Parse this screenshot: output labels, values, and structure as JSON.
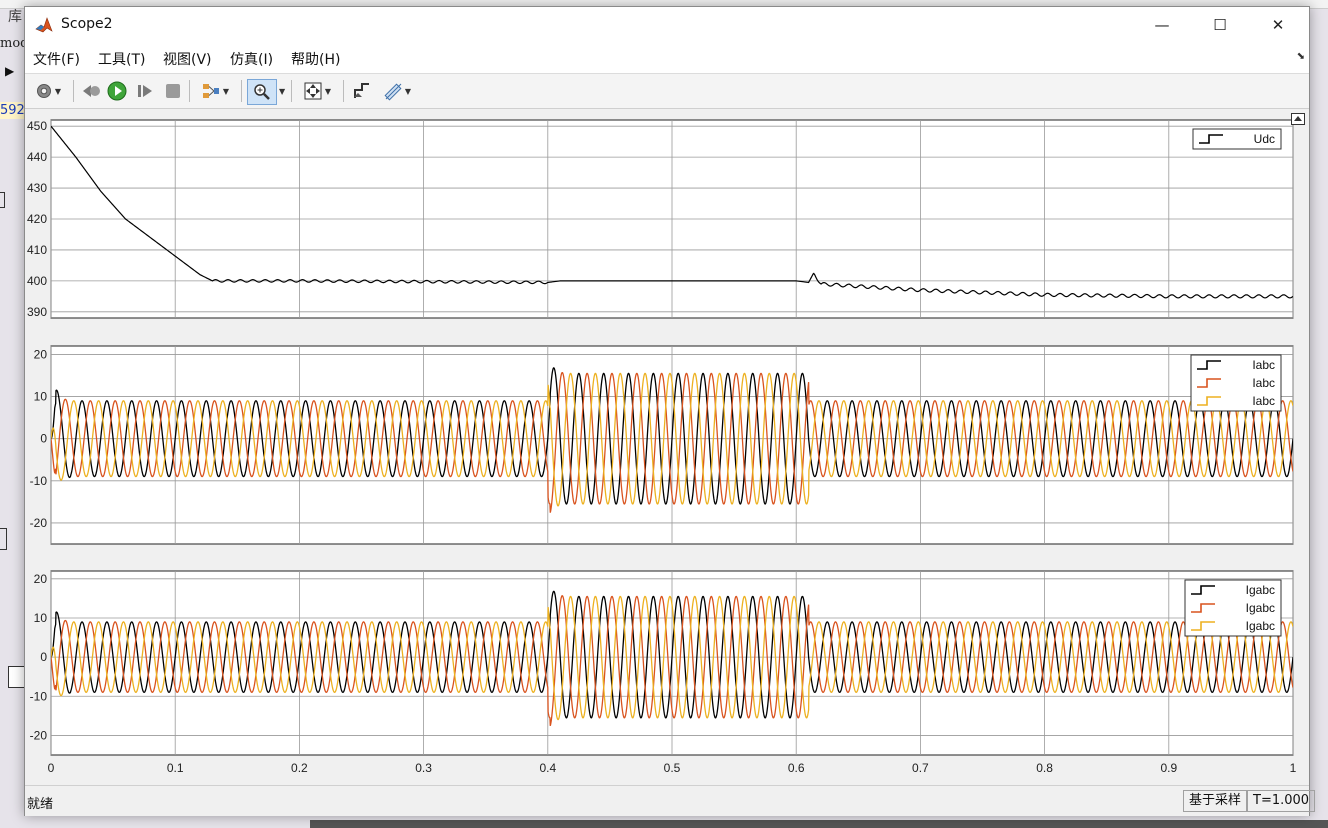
{
  "background": {
    "lib_label": "库",
    "model_label": "mode",
    "link_label": "592"
  },
  "window": {
    "title": "Scope2",
    "controls": {
      "minimize": "—",
      "maximize": "☐",
      "close": "✕"
    }
  },
  "menu": [
    "文件(F)",
    "工具(T)",
    "视图(V)",
    "仿真(I)",
    "帮助(H)"
  ],
  "toolbar": [
    {
      "icon": "gear-icon",
      "dropdown": true
    },
    {
      "icon": "step-back-icon"
    },
    {
      "icon": "run-icon"
    },
    {
      "icon": "step-forward-icon"
    },
    {
      "icon": "stop-icon"
    },
    {
      "icon": "signal-selector-icon",
      "dropdown": true
    },
    {
      "icon": "zoom-icon",
      "dropdown": true,
      "active": true
    },
    {
      "icon": "fit-axes-icon",
      "dropdown": true
    },
    {
      "icon": "triggers-icon"
    },
    {
      "icon": "cursor-measure-icon",
      "dropdown": true
    }
  ],
  "status": {
    "text": "就绪",
    "mode": "基于采样",
    "time": "T=1.000"
  },
  "colors": {
    "phase_a": "#000000",
    "phase_b": "#d9531e",
    "phase_c": "#edb120",
    "udc": "#000000"
  },
  "chart_data": [
    {
      "type": "line",
      "title": "",
      "x_range": [
        0,
        1
      ],
      "y_range": [
        388,
        452
      ],
      "y_ticks": [
        390,
        400,
        410,
        420,
        430,
        440,
        450
      ],
      "x_ticks": [
        0,
        0.1,
        0.2,
        0.3,
        0.4,
        0.5,
        0.6,
        0.7,
        0.8,
        0.9,
        1
      ],
      "x_tick_labels": [],
      "grid": true,
      "legend_position": "top-right",
      "series": [
        {
          "name": "Udc",
          "color": "#000000",
          "points": [
            [
              0,
              450
            ],
            [
              0.02,
              440
            ],
            [
              0.04,
              429
            ],
            [
              0.06,
              420
            ],
            [
              0.08,
              414
            ],
            [
              0.1,
              408
            ],
            [
              0.12,
              402
            ],
            [
              0.13,
              400
            ],
            [
              0.2,
              400
            ],
            [
              0.4,
              399.5
            ],
            [
              0.41,
              400
            ],
            [
              0.6,
              400
            ],
            [
              0.61,
              399.5
            ],
            [
              0.614,
              402.5
            ],
            [
              0.62,
              399
            ],
            [
              0.7,
              397
            ],
            [
              0.8,
              395.5
            ],
            [
              0.9,
              395
            ],
            [
              1,
              395
            ]
          ],
          "ripple": [
            [
              0.13,
              0.4,
              0.4
            ],
            [
              0.615,
              1,
              0.5
            ]
          ]
        }
      ]
    },
    {
      "type": "line",
      "x_range": [
        0,
        1
      ],
      "y_range": [
        -25,
        22
      ],
      "y_ticks": [
        -20,
        -10,
        0,
        10,
        20
      ],
      "x_ticks": [
        0,
        0.1,
        0.2,
        0.3,
        0.4,
        0.5,
        0.6,
        0.7,
        0.8,
        0.9,
        1
      ],
      "x_tick_labels": [],
      "grid": true,
      "legend_position": "top-right",
      "frequency_hz": 50,
      "amplitude_segments": [
        [
          0,
          0.4,
          9
        ],
        [
          0.4,
          0.61,
          15.5
        ],
        [
          0.61,
          1,
          9
        ]
      ],
      "transients": [
        [
          0.004,
          14
        ],
        [
          0.402,
          20
        ]
      ],
      "series": [
        {
          "name": "Iabc",
          "color": "#000000",
          "phase_deg": 0
        },
        {
          "name": "Iabc",
          "color": "#d9531e",
          "phase_deg": -120
        },
        {
          "name": "Iabc",
          "color": "#edb120",
          "phase_deg": 120
        }
      ]
    },
    {
      "type": "line",
      "x_range": [
        0,
        1
      ],
      "y_range": [
        -25,
        22
      ],
      "y_ticks": [
        -20,
        -10,
        0,
        10,
        20
      ],
      "x_ticks": [
        0,
        0.1,
        0.2,
        0.3,
        0.4,
        0.5,
        0.6,
        0.7,
        0.8,
        0.9,
        1
      ],
      "x_tick_labels": [
        "0",
        "0.1",
        "0.2",
        "0.3",
        "0.4",
        "0.5",
        "0.6",
        "0.7",
        "0.8",
        "0.9",
        "1"
      ],
      "grid": true,
      "legend_position": "top-right",
      "frequency_hz": 50,
      "amplitude_segments": [
        [
          0,
          0.4,
          9
        ],
        [
          0.4,
          0.61,
          15.5
        ],
        [
          0.61,
          1,
          9
        ]
      ],
      "transients": [
        [
          0.004,
          14
        ],
        [
          0.402,
          20
        ]
      ],
      "series": [
        {
          "name": "Igabc",
          "color": "#000000",
          "phase_deg": 0
        },
        {
          "name": "Igabc",
          "color": "#d9531e",
          "phase_deg": -120
        },
        {
          "name": "Igabc",
          "color": "#edb120",
          "phase_deg": 120
        }
      ]
    }
  ]
}
